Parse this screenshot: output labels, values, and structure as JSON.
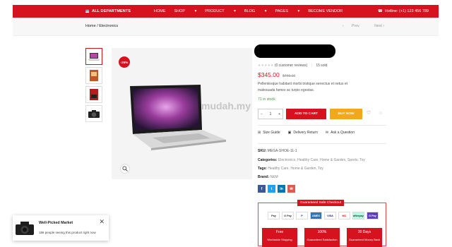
{
  "header": {
    "all_departments": "ALL DEPARTMENTS",
    "nav": [
      "HOME",
      "SHOP",
      "PRODUCT",
      "BLOG",
      "PAGES",
      "BECOME VENDOR"
    ],
    "hotline": "Hotline: (+1) 123 456 789"
  },
  "breadcrumb": {
    "text": "Home / Electronics",
    "prev": "Prev",
    "next": "Next"
  },
  "product": {
    "discount": "-26%",
    "reviews": "(0 customer reviews)",
    "sold": "15 sold",
    "price": "$345.00",
    "old_price": "$465.16",
    "description_line1": "Pellentesque habitant morbi tristique senectus et netus et",
    "description_line2": "malesuada fames ac turpis egestas.",
    "stock": "71 in stock",
    "qty": "1",
    "add_to_cart": "ADD TO CART",
    "buy_now": "BUY NOW",
    "links": [
      "Size Guide",
      "Delivery Return",
      "Ask a Question"
    ],
    "sku_label": "SKU:",
    "sku": "MEGA-SHOE-11-1",
    "categories_label": "Categories:",
    "categories": "Electronics, Healthy Care, Home & Garden, Sports, Toy",
    "tags_label": "Tags:",
    "tags": "Healthy Care, Home & Garden, Toy",
    "brand_label": "Brand:",
    "brand": "N&M"
  },
  "social": [
    "f",
    "t",
    "in",
    "✉"
  ],
  "checkout": {
    "title": "Guaranteed Safe Checkout",
    "payments": [
      "Pay",
      "G Pay",
      "P",
      "AMEX",
      "VISA",
      "MC",
      "afterpay",
      "G Pay"
    ],
    "badges": [
      {
        "title": "Free",
        "sub": "Worldwide Shipping"
      },
      {
        "title": "100%",
        "sub": "Guaranteed Satisfaction"
      },
      {
        "title": "30 Days",
        "sub": "Guaranteed Money Back"
      }
    ]
  },
  "toast": {
    "title": "Well-Picked Market",
    "message": "186 people seeing this product right now"
  },
  "watermark": "mudah.my",
  "colors": {
    "brand_red": "#d6121f",
    "buy_orange": "#f2a81d",
    "stock_green": "#2e9e3b"
  }
}
